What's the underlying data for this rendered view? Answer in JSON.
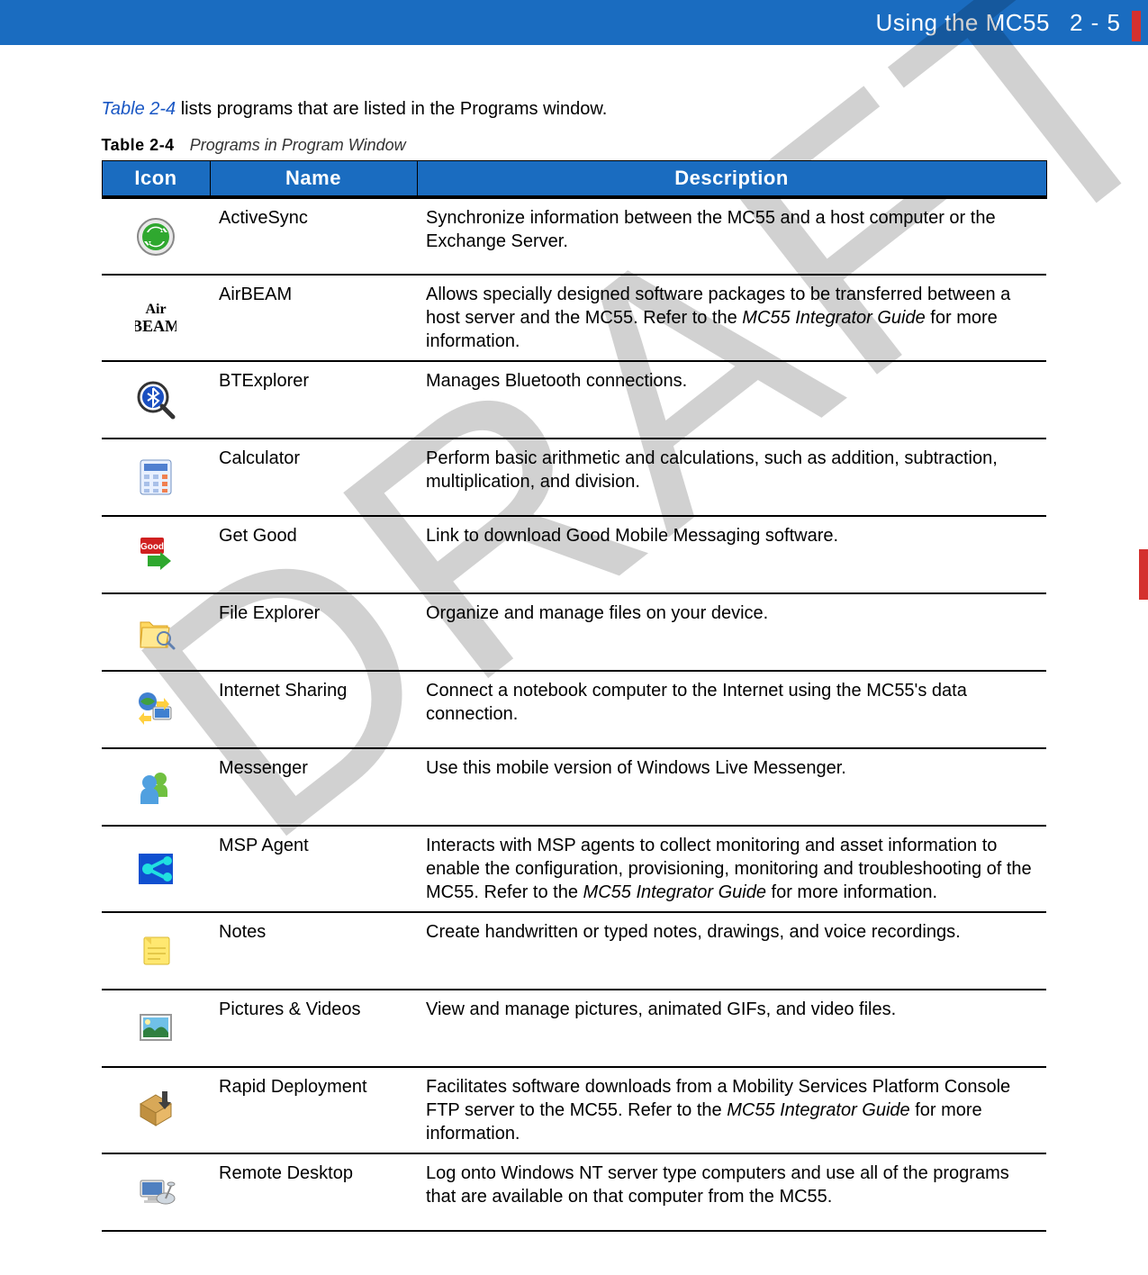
{
  "header": {
    "section_title": "Using the MC55",
    "page_number": "2 - 5"
  },
  "watermark": "DRAFT",
  "intro": {
    "ref": "Table 2-4",
    "rest": " lists programs that are listed in the Programs window."
  },
  "caption": {
    "label": "Table 2-4",
    "text": "Programs in Program Window"
  },
  "columns": {
    "icon": "Icon",
    "name": "Name",
    "description": "Description"
  },
  "rows": [
    {
      "icon": "activesync-icon",
      "name": "ActiveSync",
      "desc_parts": [
        {
          "t": "Synchronize information between the MC55 and a host computer or the Exchange Server."
        }
      ]
    },
    {
      "icon": "airbeam-icon",
      "name": "AirBEAM",
      "desc_parts": [
        {
          "t": "Allows specially designed software packages to be transferred between a host server and the MC55. Refer to the "
        },
        {
          "t": "MC55 Integrator Guide",
          "i": true
        },
        {
          "t": " for more information."
        }
      ]
    },
    {
      "icon": "btexplorer-icon",
      "name": "BTExplorer",
      "desc_parts": [
        {
          "t": "Manages Bluetooth connections."
        }
      ]
    },
    {
      "icon": "calculator-icon",
      "name": "Calculator",
      "desc_parts": [
        {
          "t": "Perform basic arithmetic and calculations, such as addition, subtraction, multiplication, and division."
        }
      ]
    },
    {
      "icon": "getgood-icon",
      "name": "Get Good",
      "desc_parts": [
        {
          "t": "Link to download Good Mobile Messaging software."
        }
      ]
    },
    {
      "icon": "fileexplorer-icon",
      "name": "File Explorer",
      "desc_parts": [
        {
          "t": "Organize and manage files on your device."
        }
      ]
    },
    {
      "icon": "internetsharing-icon",
      "name": "Internet Sharing",
      "desc_parts": [
        {
          "t": "Connect a notebook computer to the Internet using the MC55's data connection."
        }
      ]
    },
    {
      "icon": "messenger-icon",
      "name": "Messenger",
      "desc_parts": [
        {
          "t": "Use this mobile version of Windows Live Messenger."
        }
      ]
    },
    {
      "icon": "mspagent-icon",
      "name": "MSP Agent",
      "desc_parts": [
        {
          "t": "Interacts with MSP agents to collect monitoring and asset information to enable the configuration, provisioning, monitoring and troubleshooting of the MC55. Refer to the "
        },
        {
          "t": "MC55 Integrator Guide",
          "i": true
        },
        {
          "t": " for more information."
        }
      ]
    },
    {
      "icon": "notes-icon",
      "name": "Notes",
      "desc_parts": [
        {
          "t": "Create handwritten or typed notes, drawings, and voice recordings."
        }
      ]
    },
    {
      "icon": "pictures-icon",
      "name": "Pictures & Videos",
      "desc_parts": [
        {
          "t": "View and manage pictures, animated GIFs, and video files."
        }
      ]
    },
    {
      "icon": "rapiddeploy-icon",
      "name": "Rapid Deployment",
      "desc_parts": [
        {
          "t": "Facilitates software downloads from a Mobility Services Platform Console FTP server to the MC55. Refer to the "
        },
        {
          "t": "MC55 Integrator Guide",
          "i": true
        },
        {
          "t": " for more information."
        }
      ]
    },
    {
      "icon": "remotedesktop-icon",
      "name": "Remote Desktop",
      "desc_parts": [
        {
          "t": "Log onto Windows NT server type computers and use all of the programs that are available on that computer from the MC55."
        }
      ]
    }
  ]
}
